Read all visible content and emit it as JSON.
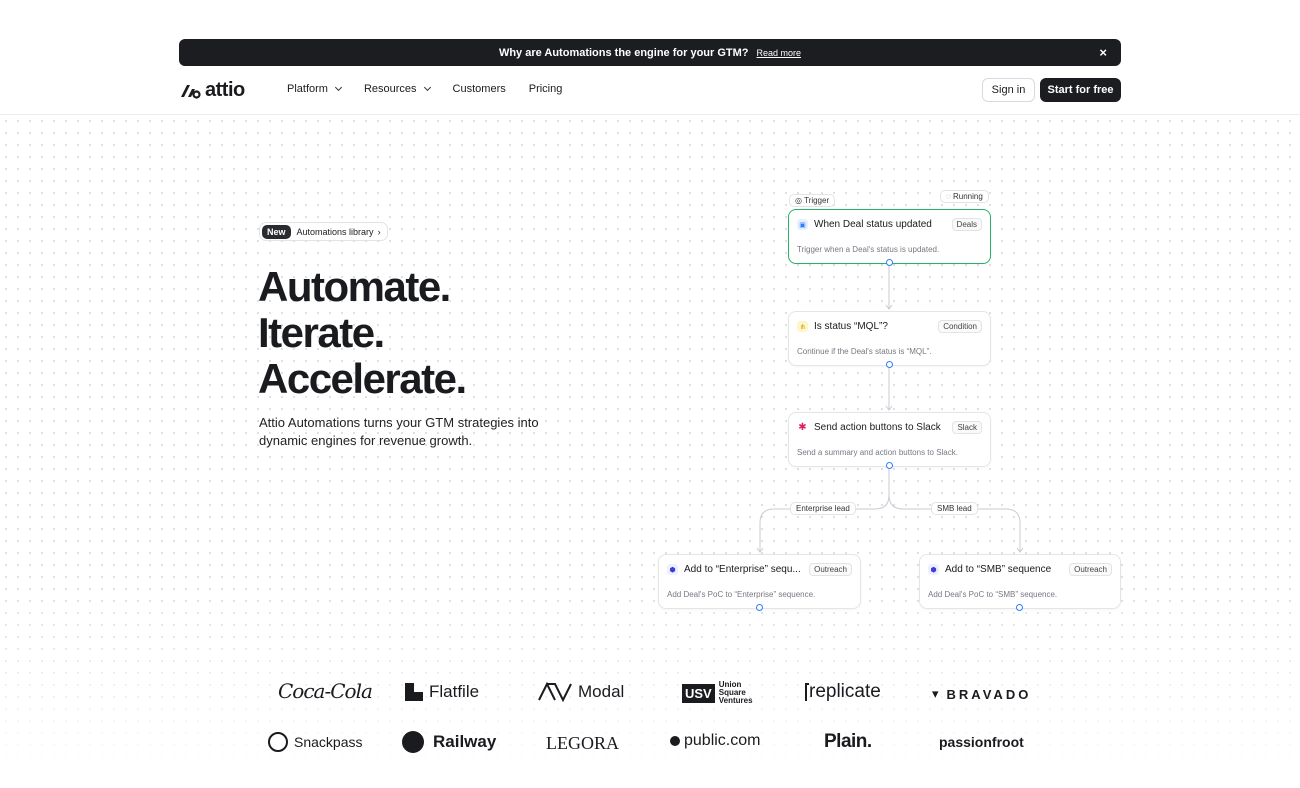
{
  "announcement": {
    "text": "Why are Automations the engine for your GTM?",
    "link": "Read more",
    "close": "×"
  },
  "nav": {
    "brand": "attio",
    "menu": [
      {
        "label": "Platform",
        "dropdown": true
      },
      {
        "label": "Resources",
        "dropdown": true
      },
      {
        "label": "Customers",
        "dropdown": false
      },
      {
        "label": "Pricing",
        "dropdown": false
      }
    ],
    "signin": "Sign in",
    "start": "Start for free"
  },
  "hero": {
    "badge": "New",
    "badge_link": "Automations library",
    "headline": [
      "Automate.",
      "Iterate.",
      "Accelerate."
    ],
    "subtitle": "Attio Automations turns your GTM strategies into dynamic engines for revenue growth."
  },
  "flow": {
    "trigger_label": "Trigger",
    "status": "Running",
    "cards": [
      {
        "title": "When Deal status updated",
        "tag": "Deals",
        "desc": "Trigger when a Deal's status is updated."
      },
      {
        "title": "Is status “MQL”?",
        "tag": "Condition",
        "desc": "Continue if the Deal's status is “MQL”."
      },
      {
        "title": "Send action buttons to Slack",
        "tag": "Slack",
        "desc": "Send a summary and action buttons to Slack."
      },
      {
        "title": "Add to “Enterprise” sequ...",
        "tag": "Outreach",
        "desc": "Add Deal's PoC to “Enterprise” sequence."
      },
      {
        "title": "Add to “SMB” sequence",
        "tag": "Outreach",
        "desc": "Add Deal's PoC to “SMB” sequence."
      }
    ],
    "branches": [
      "Enterprise lead",
      "SMB lead"
    ]
  },
  "customers": [
    "Coca-Cola",
    "Flatfile",
    "Modal",
    "USV",
    "Union Square Ventures",
    "replicate",
    "BRAVADO",
    "Snackpass",
    "Railway",
    "LEGORA",
    "public.com",
    "Plain.",
    "passionfroot"
  ],
  "colors": {
    "accent_green": "#27b06c",
    "node_blue": "#2d7ef7",
    "dark": "#1c1d21"
  }
}
